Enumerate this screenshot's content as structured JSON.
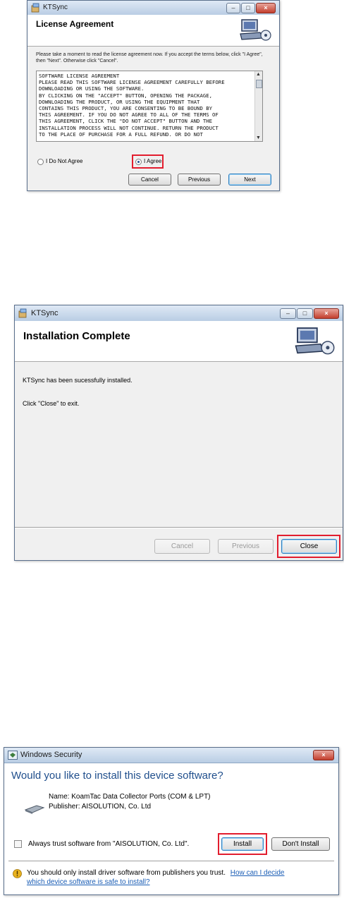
{
  "window1": {
    "title": "KTSync",
    "header_title": "License Agreement",
    "instructions": "Please take a moment to read the license agreement now. If you accept the terms below, click \"I Agree\", then \"Next\". Otherwise click \"Cancel\".",
    "license_lines": [
      "SOFTWARE LICENSE AGREEMENT",
      "PLEASE READ THIS SOFTWARE LICENSE AGREEMENT CAREFULLY BEFORE",
      "DOWNLOADING OR USING THE SOFTWARE.",
      "BY CLICKING ON THE \"ACCEPT\" BUTTON, OPENING THE PACKAGE,",
      "DOWNLOADING THE PRODUCT, OR USING THE EQUIPMENT THAT",
      "CONTAINS THIS PRODUCT, YOU ARE CONSENTING TO BE BOUND BY",
      "THIS AGREEMENT. IF YOU DO NOT AGREE TO ALL OF THE TERMS OF",
      "THIS AGREEMENT, CLICK THE \"DO NOT ACCEPT\" BUTTON AND THE",
      "INSTALLATION PROCESS WILL NOT CONTINUE. RETURN THE PRODUCT",
      "TO THE PLACE OF PURCHASE FOR A FULL REFUND. OR DO NOT"
    ],
    "radio_disagree": "I Do Not Agree",
    "radio_agree": "I Agree",
    "btn_cancel": "Cancel",
    "btn_previous": "Previous",
    "btn_next": "Next"
  },
  "window2": {
    "title": "KTSync",
    "header_title": "Installation Complete",
    "message1": "KTSync has been sucessfully installed.",
    "message2": "Click \"Close\" to exit.",
    "btn_cancel": "Cancel",
    "btn_previous": "Previous",
    "btn_close": "Close"
  },
  "window3": {
    "title": "Windows Security",
    "question": "Would you like to install this device software?",
    "name_line": "Name: KoamTac Data Collector Ports (COM & LPT)",
    "publisher_line": "Publisher: AISOLUTION, Co. Ltd",
    "checkbox_label": "Always trust software from \"AISOLUTION, Co. Ltd\".",
    "btn_install": "Install",
    "btn_dont_install": "Don't Install",
    "warning_text": "You should only install driver software from publishers you trust.",
    "link_text_1": "How can I decide",
    "link_text_2": "which device software is safe to install?"
  },
  "colors": {
    "highlight": "#e21d2e",
    "question_blue": "#1f4e8c",
    "link_blue": "#1a5db5"
  },
  "icons": {
    "app": "installer-icon",
    "header_art": "computer-cd-icon",
    "security": "shield-icon",
    "device": "device-icon",
    "warning": "warning-icon"
  }
}
